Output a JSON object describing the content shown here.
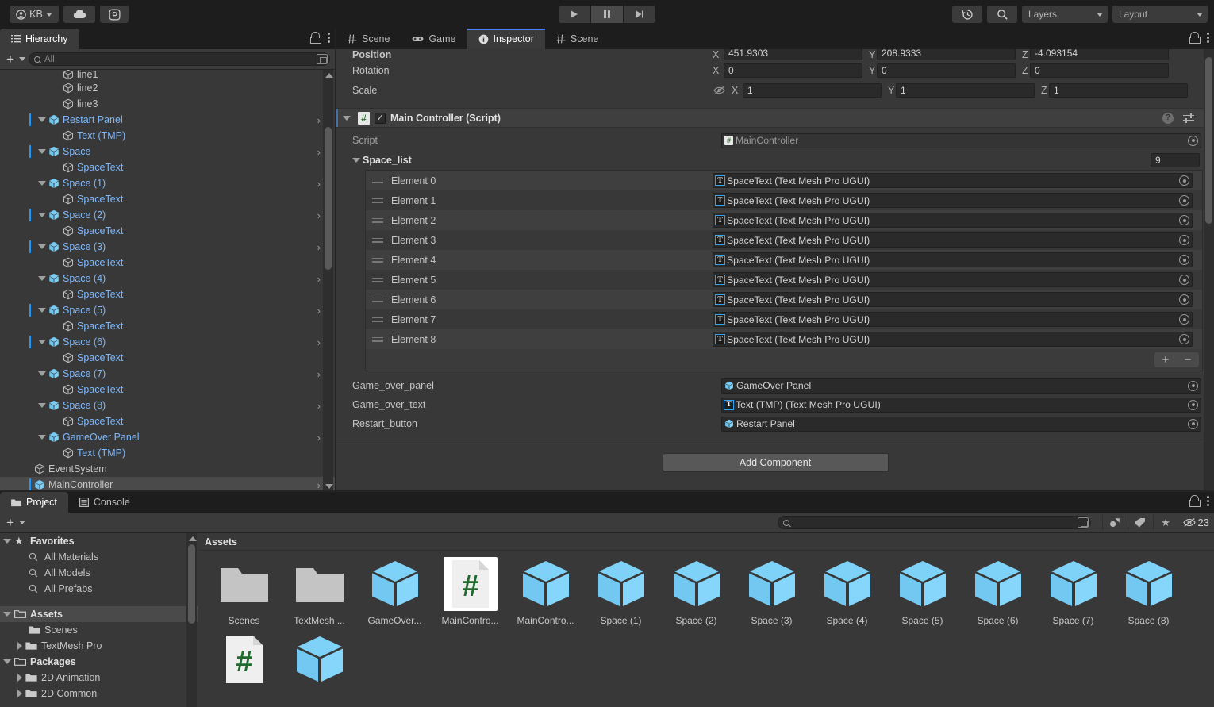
{
  "toolbar": {
    "account_label": "KB",
    "icons": [
      "account-icon",
      "cloud-icon",
      "collab-icon"
    ],
    "play_label": "▶",
    "pause_label": "❙❙",
    "step_label": "▶❙",
    "history_icon": "undo-history-icon",
    "search_icon": "search-icon",
    "layers_label": "Layers",
    "layout_label": "Layout"
  },
  "hierarchy": {
    "tab_label": "Hierarchy",
    "search_placeholder": "All",
    "add_label": "+",
    "rows": [
      {
        "name": "line1",
        "depth": 3,
        "icon": "gameobject-icon",
        "blue": false,
        "expand": "none",
        "prefab_mark": false,
        "chevron": false,
        "clipped": true
      },
      {
        "name": "line2",
        "depth": 3,
        "icon": "gameobject-icon",
        "blue": false,
        "expand": "none",
        "prefab_mark": false,
        "chevron": false
      },
      {
        "name": "line3",
        "depth": 3,
        "icon": "gameobject-icon",
        "blue": false,
        "expand": "none",
        "prefab_mark": false,
        "chevron": false
      },
      {
        "name": "Restart Panel",
        "depth": 2,
        "icon": "prefab-icon",
        "blue": true,
        "expand": "down",
        "prefab_mark": true,
        "chevron": true
      },
      {
        "name": "Text (TMP)",
        "depth": 3,
        "icon": "gameobject-icon",
        "blue": true,
        "expand": "none",
        "prefab_mark": false,
        "chevron": false
      },
      {
        "name": "Space",
        "depth": 2,
        "icon": "prefab-icon",
        "blue": true,
        "expand": "down",
        "prefab_mark": true,
        "chevron": true
      },
      {
        "name": "SpaceText",
        "depth": 3,
        "icon": "gameobject-icon",
        "blue": true,
        "expand": "none",
        "prefab_mark": false,
        "chevron": false
      },
      {
        "name": "Space (1)",
        "depth": 2,
        "icon": "prefab-icon",
        "blue": true,
        "expand": "down",
        "prefab_mark": false,
        "chevron": true
      },
      {
        "name": "SpaceText",
        "depth": 3,
        "icon": "gameobject-icon",
        "blue": true,
        "expand": "none",
        "prefab_mark": false,
        "chevron": false
      },
      {
        "name": "Space (2)",
        "depth": 2,
        "icon": "prefab-icon",
        "blue": true,
        "expand": "down",
        "prefab_mark": true,
        "chevron": true
      },
      {
        "name": "SpaceText",
        "depth": 3,
        "icon": "gameobject-icon",
        "blue": true,
        "expand": "none",
        "prefab_mark": false,
        "chevron": false
      },
      {
        "name": "Space (3)",
        "depth": 2,
        "icon": "prefab-icon",
        "blue": true,
        "expand": "down",
        "prefab_mark": true,
        "chevron": true
      },
      {
        "name": "SpaceText",
        "depth": 3,
        "icon": "gameobject-icon",
        "blue": true,
        "expand": "none",
        "prefab_mark": false,
        "chevron": false
      },
      {
        "name": "Space (4)",
        "depth": 2,
        "icon": "prefab-icon",
        "blue": true,
        "expand": "down",
        "prefab_mark": false,
        "chevron": true
      },
      {
        "name": "SpaceText",
        "depth": 3,
        "icon": "gameobject-icon",
        "blue": true,
        "expand": "none",
        "prefab_mark": false,
        "chevron": false
      },
      {
        "name": "Space (5)",
        "depth": 2,
        "icon": "prefab-icon",
        "blue": true,
        "expand": "down",
        "prefab_mark": true,
        "chevron": true
      },
      {
        "name": "SpaceText",
        "depth": 3,
        "icon": "gameobject-icon",
        "blue": true,
        "expand": "none",
        "prefab_mark": false,
        "chevron": false
      },
      {
        "name": "Space (6)",
        "depth": 2,
        "icon": "prefab-icon",
        "blue": true,
        "expand": "down",
        "prefab_mark": true,
        "chevron": true
      },
      {
        "name": "SpaceText",
        "depth": 3,
        "icon": "gameobject-icon",
        "blue": true,
        "expand": "none",
        "prefab_mark": false,
        "chevron": false
      },
      {
        "name": "Space (7)",
        "depth": 2,
        "icon": "prefab-icon",
        "blue": true,
        "expand": "down",
        "prefab_mark": false,
        "chevron": true
      },
      {
        "name": "SpaceText",
        "depth": 3,
        "icon": "gameobject-icon",
        "blue": true,
        "expand": "none",
        "prefab_mark": false,
        "chevron": false
      },
      {
        "name": "Space (8)",
        "depth": 2,
        "icon": "prefab-icon",
        "blue": true,
        "expand": "down",
        "prefab_mark": false,
        "chevron": true
      },
      {
        "name": "SpaceText",
        "depth": 3,
        "icon": "gameobject-icon",
        "blue": true,
        "expand": "none",
        "prefab_mark": false,
        "chevron": false
      },
      {
        "name": "GameOver Panel",
        "depth": 2,
        "icon": "prefab-icon",
        "blue": true,
        "expand": "down",
        "prefab_mark": false,
        "chevron": true
      },
      {
        "name": "Text (TMP)",
        "depth": 3,
        "icon": "gameobject-icon",
        "blue": true,
        "expand": "none",
        "prefab_mark": false,
        "chevron": false
      },
      {
        "name": "EventSystem",
        "depth": 1,
        "icon": "gameobject-icon",
        "blue": false,
        "expand": "none",
        "prefab_mark": false,
        "chevron": false
      },
      {
        "name": "MainController",
        "depth": 1,
        "icon": "prefab-icon",
        "blue": false,
        "expand": "none",
        "prefab_mark": true,
        "chevron": true,
        "selected": true
      }
    ]
  },
  "inspector": {
    "tabs": [
      {
        "label": "Scene",
        "icon": "scene-hash-icon",
        "active": false
      },
      {
        "label": "Game",
        "icon": "gamepad-icon",
        "active": false
      },
      {
        "label": "Inspector",
        "icon": "info-icon",
        "active": true
      },
      {
        "label": "Scene",
        "icon": "scene-hash-icon",
        "active": false
      }
    ],
    "transform": {
      "position_label": "Position",
      "rotation_label": "Rotation",
      "scale_label": "Scale",
      "axes": [
        "X",
        "Y",
        "Z"
      ],
      "position": [
        "451.9303",
        "208.9333",
        "-4.093154"
      ],
      "rotation": [
        "0",
        "0",
        "0"
      ],
      "scale": [
        "1",
        "1",
        "1"
      ]
    },
    "component": {
      "title": "Main Controller (Script)",
      "enabled": true,
      "script_label": "Script",
      "script_value": "MainController",
      "array_label": "Space_list",
      "array_size": "9",
      "elements": [
        {
          "label": "Element 0",
          "value": "SpaceText (Text Mesh Pro UGUI)"
        },
        {
          "label": "Element 1",
          "value": "SpaceText (Text Mesh Pro UGUI)"
        },
        {
          "label": "Element 2",
          "value": "SpaceText (Text Mesh Pro UGUI)"
        },
        {
          "label": "Element 3",
          "value": "SpaceText (Text Mesh Pro UGUI)"
        },
        {
          "label": "Element 4",
          "value": "SpaceText (Text Mesh Pro UGUI)"
        },
        {
          "label": "Element 5",
          "value": "SpaceText (Text Mesh Pro UGUI)"
        },
        {
          "label": "Element 6",
          "value": "SpaceText (Text Mesh Pro UGUI)"
        },
        {
          "label": "Element 7",
          "value": "SpaceText (Text Mesh Pro UGUI)"
        },
        {
          "label": "Element 8",
          "value": "SpaceText (Text Mesh Pro UGUI)"
        }
      ],
      "add_element_label": "+",
      "remove_element_label": "−",
      "fields": [
        {
          "label": "Game_over_panel",
          "value": "GameOver Panel",
          "icon": "prefab-icon"
        },
        {
          "label": "Game_over_text",
          "value": "Text (TMP) (Text Mesh Pro UGUI)",
          "icon": "tmp-icon"
        },
        {
          "label": "Restart_button",
          "value": "Restart Panel",
          "icon": "prefab-icon"
        }
      ]
    },
    "add_component_label": "Add Component"
  },
  "project": {
    "tabs": [
      {
        "label": "Project",
        "icon": "folder-icon",
        "active": true
      },
      {
        "label": "Console",
        "icon": "console-icon",
        "active": false
      }
    ],
    "add_label": "+",
    "search_placeholder": "",
    "icon_count": "23",
    "tree": [
      {
        "label": "Favorites",
        "depth": 0,
        "twisty": "down",
        "icon": "star-icon",
        "bold": true
      },
      {
        "label": "All Materials",
        "depth": 1,
        "twisty": "none",
        "icon": "search-icon",
        "bold": false
      },
      {
        "label": "All Models",
        "depth": 1,
        "twisty": "none",
        "icon": "search-icon",
        "bold": false
      },
      {
        "label": "All Prefabs",
        "depth": 1,
        "twisty": "none",
        "icon": "search-icon",
        "bold": false
      },
      {
        "label": "",
        "depth": 0,
        "twisty": "none",
        "icon": "none",
        "bold": false
      },
      {
        "label": "Assets",
        "depth": 0,
        "twisty": "down",
        "icon": "folder-open-icon",
        "bold": true,
        "selected": true
      },
      {
        "label": "Scenes",
        "depth": 1,
        "twisty": "none",
        "icon": "folder-icon",
        "bold": false
      },
      {
        "label": "TextMesh Pro",
        "depth": 1,
        "twisty": "right",
        "icon": "folder-icon",
        "bold": false
      },
      {
        "label": "Packages",
        "depth": 0,
        "twisty": "down",
        "icon": "folder-open-icon",
        "bold": true
      },
      {
        "label": "2D Animation",
        "depth": 1,
        "twisty": "right",
        "icon": "folder-icon",
        "bold": false
      },
      {
        "label": "2D Common",
        "depth": 1,
        "twisty": "right",
        "icon": "folder-icon",
        "bold": false
      }
    ],
    "assets_header": "Assets",
    "assets": [
      {
        "label": "Scenes",
        "type": "folder",
        "selected": false
      },
      {
        "label": "TextMesh ...",
        "type": "folder",
        "selected": false
      },
      {
        "label": "GameOver...",
        "type": "prefab",
        "selected": false
      },
      {
        "label": "MainContro...",
        "type": "script",
        "selected": true
      },
      {
        "label": "MainContro...",
        "type": "prefab",
        "selected": false
      },
      {
        "label": "Space (1)",
        "type": "prefab",
        "selected": false
      },
      {
        "label": "Space (2)",
        "type": "prefab",
        "selected": false
      },
      {
        "label": "Space (3)",
        "type": "prefab",
        "selected": false
      },
      {
        "label": "Space (4)",
        "type": "prefab",
        "selected": false
      },
      {
        "label": "Space (5)",
        "type": "prefab",
        "selected": false
      },
      {
        "label": "Space (6)",
        "type": "prefab",
        "selected": false
      },
      {
        "label": "Space (7)",
        "type": "prefab",
        "selected": false
      },
      {
        "label": "Space (8)",
        "type": "prefab",
        "selected": false
      },
      {
        "label": "",
        "type": "script",
        "selected": false
      },
      {
        "label": "",
        "type": "prefab",
        "selected": false
      }
    ]
  },
  "colors": {
    "accent_blue": "#2196f3",
    "prefab_blue": "#7fb7f7",
    "panel_bg": "#383838",
    "tab_active": "#3b3b3b",
    "selection": "#4a4a4a"
  }
}
